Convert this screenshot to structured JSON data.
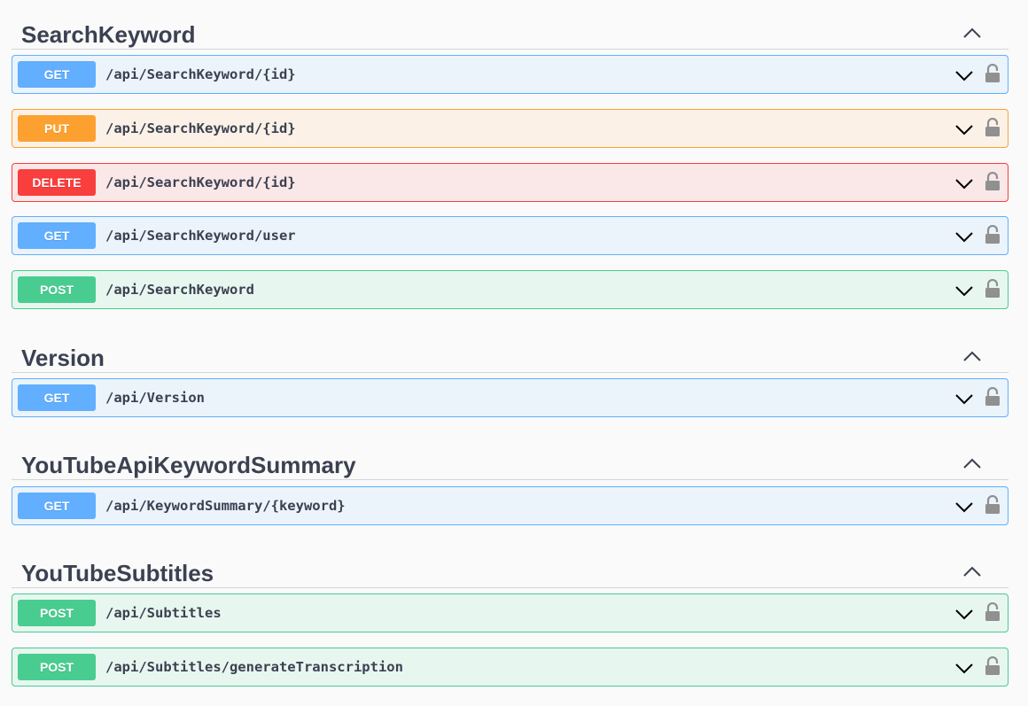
{
  "sections": [
    {
      "title": "SearchKeyword",
      "operations": [
        {
          "method": "GET",
          "path": "/api/SearchKeyword/{id}"
        },
        {
          "method": "PUT",
          "path": "/api/SearchKeyword/{id}"
        },
        {
          "method": "DELETE",
          "path": "/api/SearchKeyword/{id}"
        },
        {
          "method": "GET",
          "path": "/api/SearchKeyword/user"
        },
        {
          "method": "POST",
          "path": "/api/SearchKeyword"
        }
      ]
    },
    {
      "title": "Version",
      "operations": [
        {
          "method": "GET",
          "path": "/api/Version"
        }
      ]
    },
    {
      "title": "YouTubeApiKeywordSummary",
      "operations": [
        {
          "method": "GET",
          "path": "/api/KeywordSummary/{keyword}"
        }
      ]
    },
    {
      "title": "YouTubeSubtitles",
      "operations": [
        {
          "method": "POST",
          "path": "/api/Subtitles"
        },
        {
          "method": "POST",
          "path": "/api/Subtitles/generateTranscription"
        }
      ]
    }
  ],
  "icons": {
    "collapse": "chevron-up-icon",
    "expand": "chevron-down-icon",
    "auth": "lock-icon"
  },
  "colors": {
    "get": "#61affe",
    "put": "#fca130",
    "delete": "#f93e3e",
    "post": "#49cc90"
  }
}
